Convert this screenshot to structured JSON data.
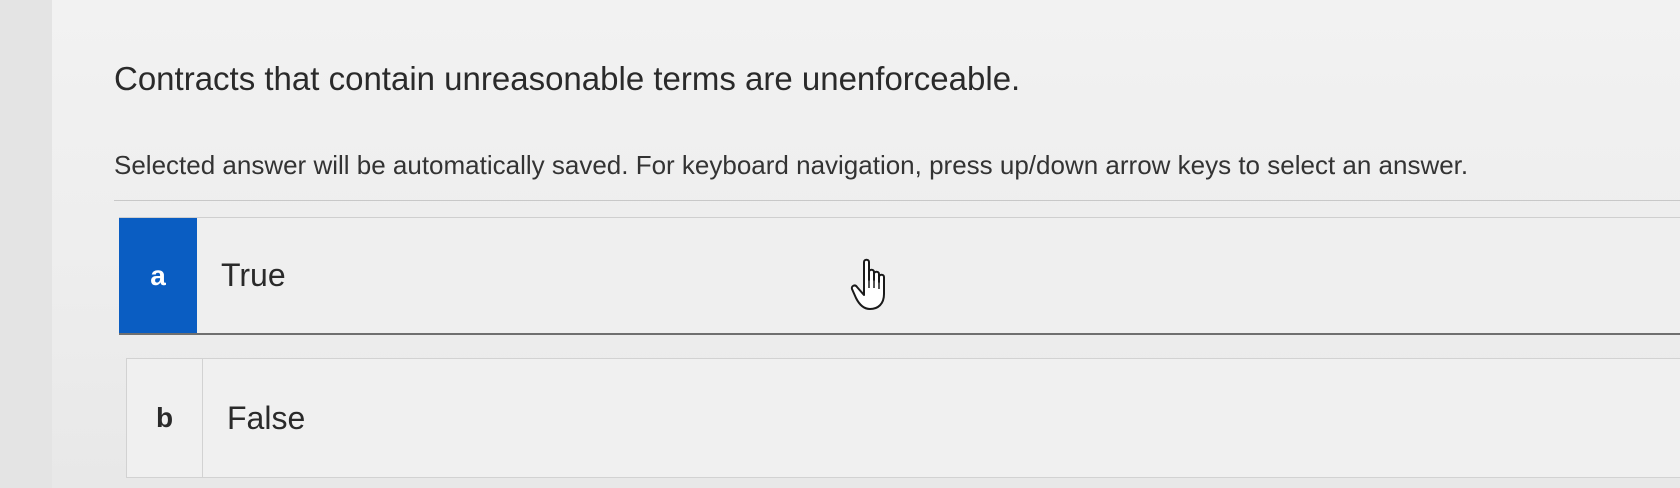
{
  "question": {
    "title": "Contracts that contain unreasonable terms are unenforceable.",
    "instructions": "Selected answer will be automatically saved. For keyboard navigation, press up/down arrow keys to select an answer."
  },
  "options": [
    {
      "letter": "a",
      "text": "True",
      "selected": true
    },
    {
      "letter": "b",
      "text": "False",
      "selected": false
    }
  ],
  "colors": {
    "selected_accent": "#0a5dc2",
    "background": "#ededed"
  },
  "icons": {
    "cursor": "hand-pointer-icon"
  }
}
